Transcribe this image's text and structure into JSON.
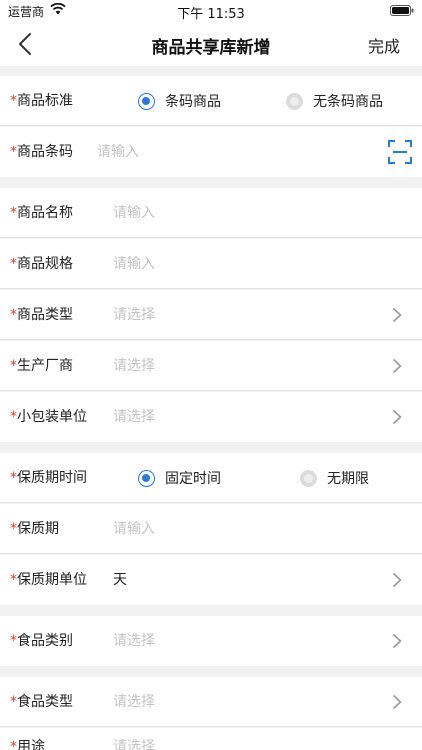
{
  "status_bar": {
    "carrier": "运营商",
    "time": "下午 11:53"
  },
  "nav": {
    "title": "商品共享库新增",
    "done_label": "完成"
  },
  "required_mark": "*",
  "form": {
    "standard": {
      "label": "商品标准",
      "options": [
        "条码商品",
        "无条码商品"
      ],
      "selected": "条码商品"
    },
    "barcode": {
      "label": "商品条码",
      "placeholder": "请输入"
    },
    "name": {
      "label": "商品名称",
      "placeholder": "请输入"
    },
    "spec": {
      "label": "商品规格",
      "placeholder": "请输入"
    },
    "category": {
      "label": "商品类型",
      "placeholder": "请选择"
    },
    "manufacturer": {
      "label": "生产厂商",
      "placeholder": "请选择"
    },
    "package_unit": {
      "label": "小包装单位",
      "placeholder": "请选择"
    },
    "shelf_life_type": {
      "label": "保质期时间",
      "options": [
        "固定时间",
        "无期限"
      ],
      "selected": "固定时间"
    },
    "shelf_life": {
      "label": "保质期",
      "placeholder": "请输入"
    },
    "shelf_life_unit": {
      "label": "保质期单位",
      "value": "天"
    },
    "food_class": {
      "label": "食品类别",
      "placeholder": "请选择"
    },
    "food_type": {
      "label": "食品类型",
      "placeholder": "请选择"
    },
    "usage": {
      "label": "用途",
      "placeholder": "请选择"
    }
  },
  "colors": {
    "accent": "#2b7ad1",
    "required": "#e03a2f",
    "placeholder": "#c4c4c4"
  }
}
